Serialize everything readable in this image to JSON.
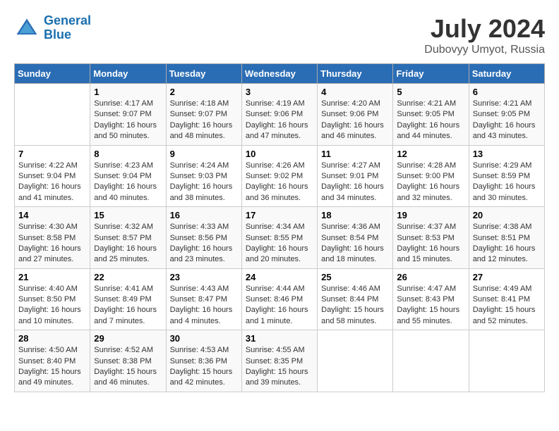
{
  "header": {
    "logo_line1": "General",
    "logo_line2": "Blue",
    "month_year": "July 2024",
    "location": "Dubovyy Umyot, Russia"
  },
  "weekdays": [
    "Sunday",
    "Monday",
    "Tuesday",
    "Wednesday",
    "Thursday",
    "Friday",
    "Saturday"
  ],
  "weeks": [
    [
      {
        "day": "",
        "info": ""
      },
      {
        "day": "1",
        "info": "Sunrise: 4:17 AM\nSunset: 9:07 PM\nDaylight: 16 hours\nand 50 minutes."
      },
      {
        "day": "2",
        "info": "Sunrise: 4:18 AM\nSunset: 9:07 PM\nDaylight: 16 hours\nand 48 minutes."
      },
      {
        "day": "3",
        "info": "Sunrise: 4:19 AM\nSunset: 9:06 PM\nDaylight: 16 hours\nand 47 minutes."
      },
      {
        "day": "4",
        "info": "Sunrise: 4:20 AM\nSunset: 9:06 PM\nDaylight: 16 hours\nand 46 minutes."
      },
      {
        "day": "5",
        "info": "Sunrise: 4:21 AM\nSunset: 9:05 PM\nDaylight: 16 hours\nand 44 minutes."
      },
      {
        "day": "6",
        "info": "Sunrise: 4:21 AM\nSunset: 9:05 PM\nDaylight: 16 hours\nand 43 minutes."
      }
    ],
    [
      {
        "day": "7",
        "info": "Sunrise: 4:22 AM\nSunset: 9:04 PM\nDaylight: 16 hours\nand 41 minutes."
      },
      {
        "day": "8",
        "info": "Sunrise: 4:23 AM\nSunset: 9:04 PM\nDaylight: 16 hours\nand 40 minutes."
      },
      {
        "day": "9",
        "info": "Sunrise: 4:24 AM\nSunset: 9:03 PM\nDaylight: 16 hours\nand 38 minutes."
      },
      {
        "day": "10",
        "info": "Sunrise: 4:26 AM\nSunset: 9:02 PM\nDaylight: 16 hours\nand 36 minutes."
      },
      {
        "day": "11",
        "info": "Sunrise: 4:27 AM\nSunset: 9:01 PM\nDaylight: 16 hours\nand 34 minutes."
      },
      {
        "day": "12",
        "info": "Sunrise: 4:28 AM\nSunset: 9:00 PM\nDaylight: 16 hours\nand 32 minutes."
      },
      {
        "day": "13",
        "info": "Sunrise: 4:29 AM\nSunset: 8:59 PM\nDaylight: 16 hours\nand 30 minutes."
      }
    ],
    [
      {
        "day": "14",
        "info": "Sunrise: 4:30 AM\nSunset: 8:58 PM\nDaylight: 16 hours\nand 27 minutes."
      },
      {
        "day": "15",
        "info": "Sunrise: 4:32 AM\nSunset: 8:57 PM\nDaylight: 16 hours\nand 25 minutes."
      },
      {
        "day": "16",
        "info": "Sunrise: 4:33 AM\nSunset: 8:56 PM\nDaylight: 16 hours\nand 23 minutes."
      },
      {
        "day": "17",
        "info": "Sunrise: 4:34 AM\nSunset: 8:55 PM\nDaylight: 16 hours\nand 20 minutes."
      },
      {
        "day": "18",
        "info": "Sunrise: 4:36 AM\nSunset: 8:54 PM\nDaylight: 16 hours\nand 18 minutes."
      },
      {
        "day": "19",
        "info": "Sunrise: 4:37 AM\nSunset: 8:53 PM\nDaylight: 16 hours\nand 15 minutes."
      },
      {
        "day": "20",
        "info": "Sunrise: 4:38 AM\nSunset: 8:51 PM\nDaylight: 16 hours\nand 12 minutes."
      }
    ],
    [
      {
        "day": "21",
        "info": "Sunrise: 4:40 AM\nSunset: 8:50 PM\nDaylight: 16 hours\nand 10 minutes."
      },
      {
        "day": "22",
        "info": "Sunrise: 4:41 AM\nSunset: 8:49 PM\nDaylight: 16 hours\nand 7 minutes."
      },
      {
        "day": "23",
        "info": "Sunrise: 4:43 AM\nSunset: 8:47 PM\nDaylight: 16 hours\nand 4 minutes."
      },
      {
        "day": "24",
        "info": "Sunrise: 4:44 AM\nSunset: 8:46 PM\nDaylight: 16 hours\nand 1 minute."
      },
      {
        "day": "25",
        "info": "Sunrise: 4:46 AM\nSunset: 8:44 PM\nDaylight: 15 hours\nand 58 minutes."
      },
      {
        "day": "26",
        "info": "Sunrise: 4:47 AM\nSunset: 8:43 PM\nDaylight: 15 hours\nand 55 minutes."
      },
      {
        "day": "27",
        "info": "Sunrise: 4:49 AM\nSunset: 8:41 PM\nDaylight: 15 hours\nand 52 minutes."
      }
    ],
    [
      {
        "day": "28",
        "info": "Sunrise: 4:50 AM\nSunset: 8:40 PM\nDaylight: 15 hours\nand 49 minutes."
      },
      {
        "day": "29",
        "info": "Sunrise: 4:52 AM\nSunset: 8:38 PM\nDaylight: 15 hours\nand 46 minutes."
      },
      {
        "day": "30",
        "info": "Sunrise: 4:53 AM\nSunset: 8:36 PM\nDaylight: 15 hours\nand 42 minutes."
      },
      {
        "day": "31",
        "info": "Sunrise: 4:55 AM\nSunset: 8:35 PM\nDaylight: 15 hours\nand 39 minutes."
      },
      {
        "day": "",
        "info": ""
      },
      {
        "day": "",
        "info": ""
      },
      {
        "day": "",
        "info": ""
      }
    ]
  ]
}
